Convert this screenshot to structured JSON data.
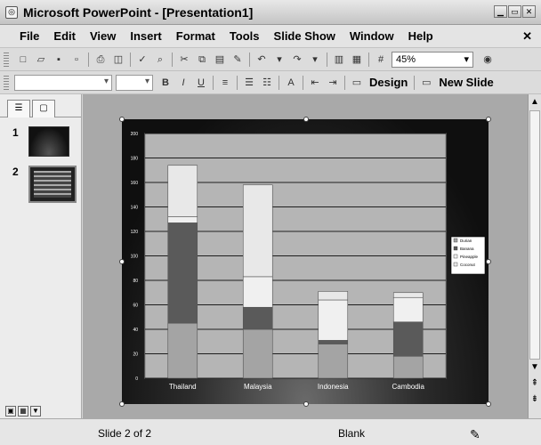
{
  "window": {
    "title": "Microsoft PowerPoint - [Presentation1]"
  },
  "menu": {
    "items": [
      "File",
      "Edit",
      "View",
      "Insert",
      "Format",
      "Tools",
      "Slide Show",
      "Window",
      "Help"
    ]
  },
  "toolbar": {
    "zoom": "45%",
    "design_label": "Design",
    "new_slide_label": "New Slide"
  },
  "thumbnails": [
    {
      "number": "1"
    },
    {
      "number": "2"
    }
  ],
  "status": {
    "slide_info": "Slide 2 of 2",
    "design": "Blank"
  },
  "chart_data": {
    "type": "bar",
    "stacked": true,
    "categories": [
      "Thailand",
      "Malaysia",
      "Indonesia",
      "Cambodia"
    ],
    "series": [
      {
        "name": "Durian",
        "values": [
          45,
          40,
          28,
          18
        ],
        "color": "#a4a4a4"
      },
      {
        "name": "Banana",
        "values": [
          82,
          18,
          3,
          28
        ],
        "color": "#5a5a5a"
      },
      {
        "name": "Pineapple",
        "values": [
          5,
          25,
          33,
          20
        ],
        "color": "#f0f0f0"
      },
      {
        "name": "Coconut",
        "values": [
          42,
          75,
          7,
          4
        ],
        "color": "#e8e8e8"
      }
    ],
    "ylim": [
      0,
      200
    ],
    "yticks": [
      0,
      20,
      40,
      60,
      80,
      100,
      120,
      140,
      160,
      180,
      200
    ],
    "grid": true,
    "legend": "right"
  }
}
